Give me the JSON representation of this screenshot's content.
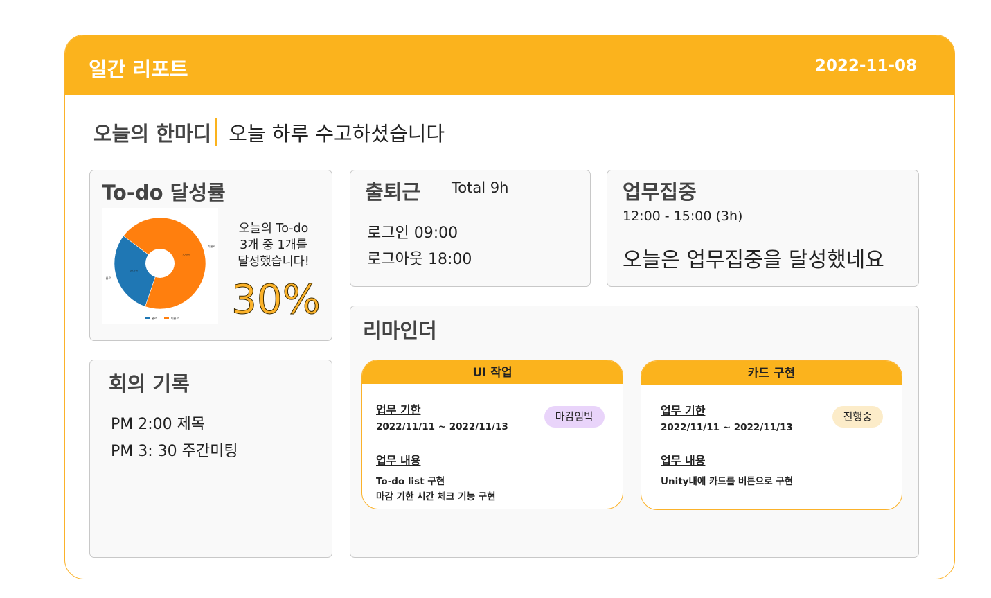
{
  "header": {
    "title": "일간 리포트",
    "date": "2022-11-08"
  },
  "motto": {
    "label": "오늘의 한마디",
    "text": "오늘 하루 수고하셨습니다"
  },
  "todo": {
    "title": "To-do 달성률",
    "message_lines": [
      "오늘의 To-do",
      "3개 중 1개를",
      "달성했습니다!"
    ],
    "percent": "30%",
    "chart_data": {
      "type": "pie",
      "categories": [
        "완료",
        "미완료"
      ],
      "values": [
        30.0,
        70.0
      ],
      "slice_labels": [
        "30.0%",
        "70.0%"
      ],
      "colors": [
        "#1F77B4",
        "#FF7F0E"
      ],
      "legend": [
        "완료",
        "미완료"
      ],
      "legend_placement": "bottom",
      "donut": true
    }
  },
  "attendance": {
    "title": "출퇴근",
    "total": "Total 9h",
    "login": "로그인 09:00",
    "logout": "로그아웃 18:00"
  },
  "focus": {
    "title": "업무집중",
    "time": "12:00 - 15:00 (3h)",
    "message": "오늘은 업무집중을 달성했네요"
  },
  "meeting": {
    "title": "회의 기록",
    "items": [
      "PM 2:00 제목",
      "PM 3: 30 주간미팅"
    ]
  },
  "reminder": {
    "title": "리마인더",
    "cards": [
      {
        "title": "UI 작업",
        "deadline_label": "업무 기한",
        "deadline": "2022/11/11 ~ 2022/11/13",
        "content_label": "업무 내용",
        "content_lines": [
          "To-do list 구현",
          "마감 기한 시간 체크 기능 구현"
        ],
        "status": "마감임박",
        "status_color": "#E9D4FA"
      },
      {
        "title": "카드 구현",
        "deadline_label": "업무 기한",
        "deadline": "2022/11/11 ~ 2022/11/13",
        "content_label": "업무 내용",
        "content_lines": [
          "Unity내에 카드를 버튼으로 구현"
        ],
        "status": "진행중",
        "status_color": "#FCECC9"
      }
    ]
  },
  "colors": {
    "accent": "#FBB31D",
    "card_border": "#C8C8C8"
  }
}
